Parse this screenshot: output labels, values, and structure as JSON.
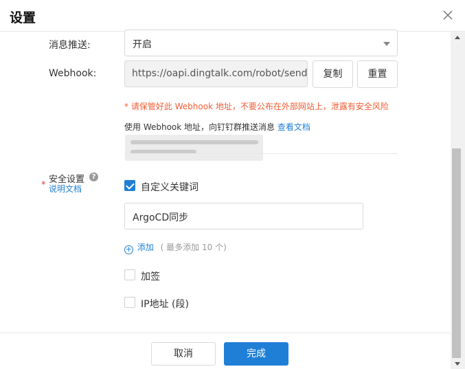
{
  "dialog": {
    "title": "设置",
    "close_icon": "close-icon"
  },
  "push": {
    "label": "消息推送:",
    "value": "开启"
  },
  "webhook": {
    "label": "Webhook:",
    "value": "https://oapi.dingtalk.com/robot/send?ac",
    "copy_label": "复制",
    "reset_label": "重置",
    "warning": "* 请保管好此 Webhook 地址，不要公布在外部网站上，泄露有安全风险",
    "info_text": "使用 Webhook 地址，向钉钉群推送消息",
    "info_link": "查看文档"
  },
  "security": {
    "required_mark": "*",
    "label": "安全设置",
    "help_icon": "question-circle-icon",
    "help_glyph": "?",
    "doc_link": "说明文档",
    "keyword_option": {
      "label": "自定义关键词",
      "checked": true,
      "keyword_value": "ArgoCD同步",
      "add_label": "添加",
      "add_hint": "( 最多添加 10 个)"
    },
    "sign_option": {
      "label": "加签",
      "checked": false
    },
    "ip_option": {
      "label": "IP地址 (段)",
      "checked": false
    }
  },
  "footer": {
    "cancel_label": "取消",
    "done_label": "完成"
  },
  "colors": {
    "primary": "#1f7fd6",
    "warning": "#f25c33",
    "required": "#e53935",
    "readonly_bg": "#f2f2f2"
  }
}
